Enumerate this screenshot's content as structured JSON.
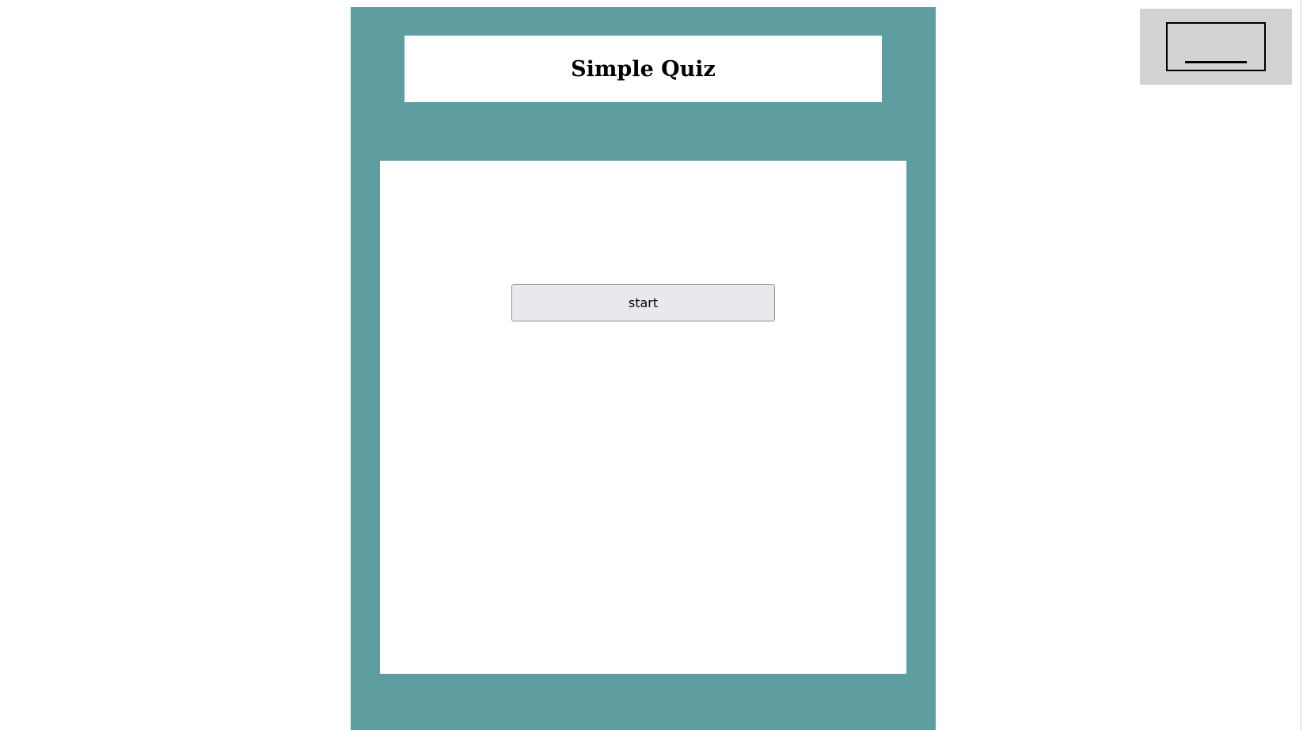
{
  "quiz": {
    "title": "Simple Quiz",
    "start_label": "start"
  },
  "corner_widget": {
    "icon": "minimize-icon"
  },
  "colors": {
    "panel": "#5f9ea0",
    "content_background": "#ffffff",
    "corner_background": "#d3d3d3",
    "button_background": "#e9e9ed"
  }
}
